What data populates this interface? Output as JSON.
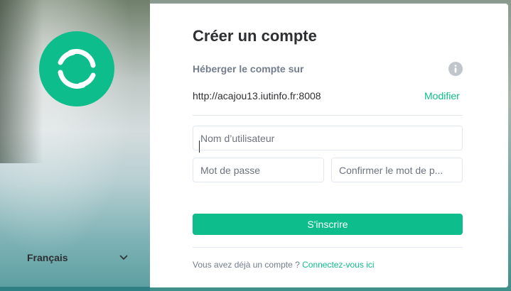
{
  "sidebar": {
    "language": "Français"
  },
  "form": {
    "title": "Créer un compte",
    "host_label": "Héberger le compte sur",
    "server_url": "http://acajou13.iutinfo.fr:8008",
    "modify_label": "Modifier",
    "username_placeholder": "Nom d’utilisateur",
    "password_placeholder": "Mot de passe",
    "confirm_placeholder": "Confirmer le mot de p...",
    "submit_label": "S'inscrire",
    "footer_text": "Vous avez déjà un compte ? ",
    "footer_link": "Connectez-vous ici"
  },
  "colors": {
    "accent": "#0dbd8b",
    "text": "#2e2f32",
    "muted": "#737d8c"
  },
  "icons": [
    "element-logo-icon",
    "info-icon",
    "chevron-down-icon"
  ]
}
